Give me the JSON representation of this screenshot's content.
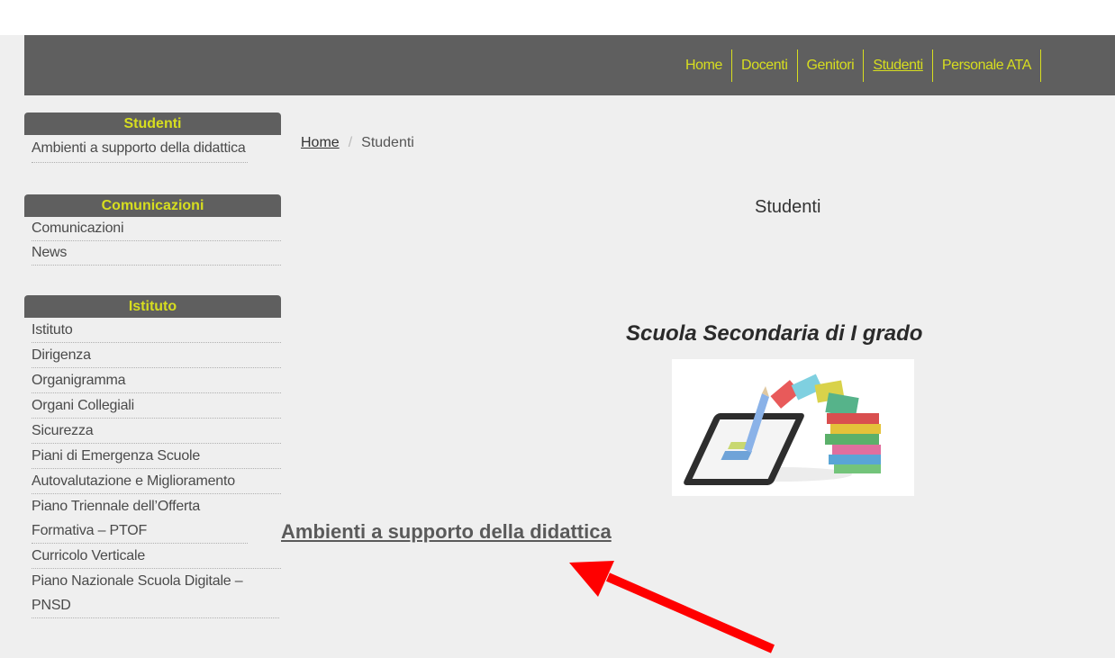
{
  "nav": {
    "items": [
      "Home",
      "Docenti",
      "Genitori",
      "Studenti",
      "Personale ATA"
    ],
    "active": "Studenti"
  },
  "sidebar": {
    "studenti": {
      "title": "Studenti",
      "items": [
        "Ambienti a supporto della didattica"
      ]
    },
    "comunicazioni": {
      "title": "Comunicazioni",
      "items": [
        "Comunicazioni",
        "News"
      ]
    },
    "istituto": {
      "title": "Istituto",
      "items": [
        "Istituto",
        "Dirigenza",
        "Organigramma",
        "Organi Collegiali",
        "Sicurezza",
        "Piani di Emergenza Scuole",
        "Autovalutazione e Miglioramento",
        "Piano Triennale dell’Offerta Formativa – PTOF",
        "Curricolo Verticale",
        "Piano Nazionale Scuola Digitale – PNSD"
      ]
    }
  },
  "breadcrumb": {
    "home": "Home",
    "separator": "/",
    "current": "Studenti"
  },
  "main": {
    "title": "Studenti",
    "subtitle": "Scuola Secondaria di I grado",
    "link": "Ambienti a supporto della didattica"
  },
  "colors": {
    "bar": "#5f5f5f",
    "accent": "#d7de1f",
    "background": "#efefef",
    "annotation_arrow": "#ff0000"
  }
}
